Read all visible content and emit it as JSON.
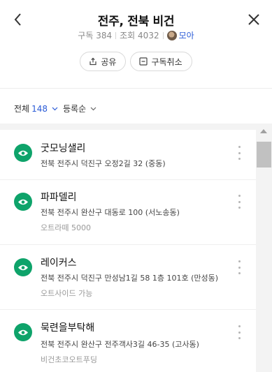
{
  "header": {
    "title": "전주, 전북 비건",
    "subscribers_label": "구독",
    "subscribers": "384",
    "views_label": "조회",
    "views": "4032",
    "owner": "모아"
  },
  "actions": {
    "share_label": "공유",
    "unsubscribe_label": "구독취소"
  },
  "filters": {
    "all_label": "전체",
    "all_count": "148",
    "sort_label": "등록순"
  },
  "places": [
    {
      "name": "굿모닝샐리",
      "address": "전북 전주시 덕진구 오정2길 32 (중동)",
      "memo": ""
    },
    {
      "name": "파파델리",
      "address": "전북 전주시 완산구 대동로 100 (서노송동)",
      "memo": "오트라떼 5000"
    },
    {
      "name": "레이커스",
      "address": "전북 전주시 덕진구 만성남1길 58 1층 101호 (만성동)",
      "memo": "오트사이드 가능"
    },
    {
      "name": "묵련을부탁해",
      "address": "전북 전주시 완산구 전주객사3길 46-35 (고사동)",
      "memo": "비건초코오트푸딩"
    }
  ],
  "colors": {
    "accent": "#2a5bd7",
    "eye_badge": "#0ea36a"
  },
  "icons": [
    "back-arrow-icon",
    "close-icon",
    "share-icon",
    "unsubscribe-icon",
    "chevron-down-icon",
    "eye-icon",
    "more-vertical-icon"
  ]
}
